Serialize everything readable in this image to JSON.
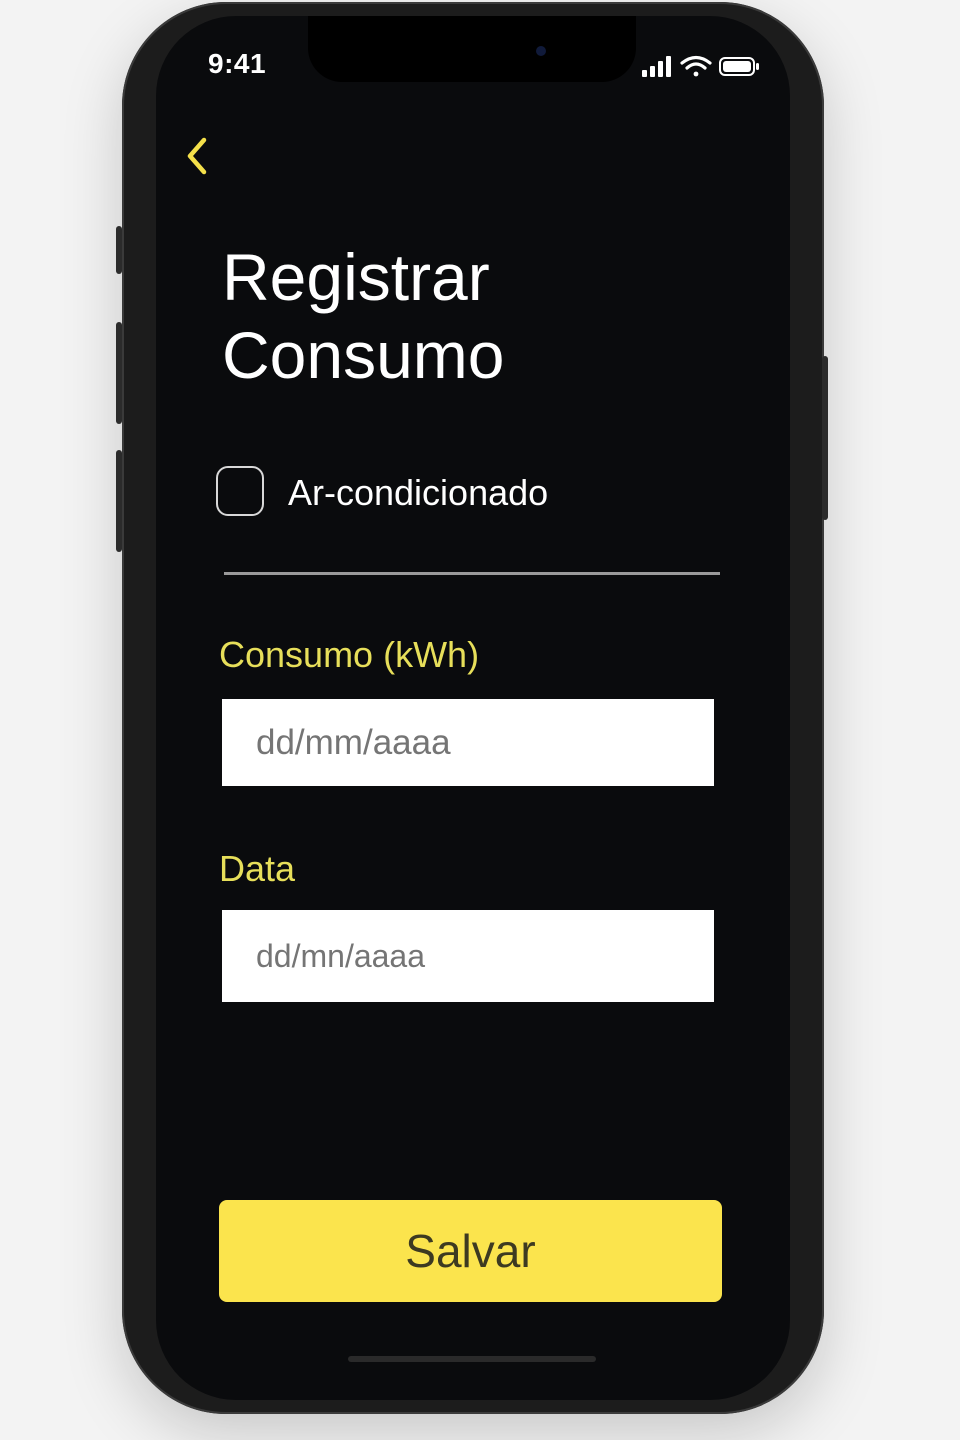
{
  "status_bar": {
    "time": "9:41",
    "icons": [
      "cellular-signal-icon",
      "wifi-icon",
      "battery-icon"
    ]
  },
  "nav": {
    "back_icon": "chevron-left-icon"
  },
  "page": {
    "title_line1": "Registrar",
    "title_line2": "Consumo"
  },
  "device": {
    "label": "Ar-condicionado",
    "checked": false
  },
  "fields": {
    "consumo": {
      "label": "Consumo (kWh)",
      "placeholder": "dd/mm/aaaa"
    },
    "data": {
      "label": "Data",
      "placeholder": "dd/mn/aaaa"
    }
  },
  "actions": {
    "save_label": "Salvar"
  },
  "colors": {
    "accent": "#fbe44d",
    "label_accent": "#e7df5a",
    "background": "#0a0b0d"
  }
}
